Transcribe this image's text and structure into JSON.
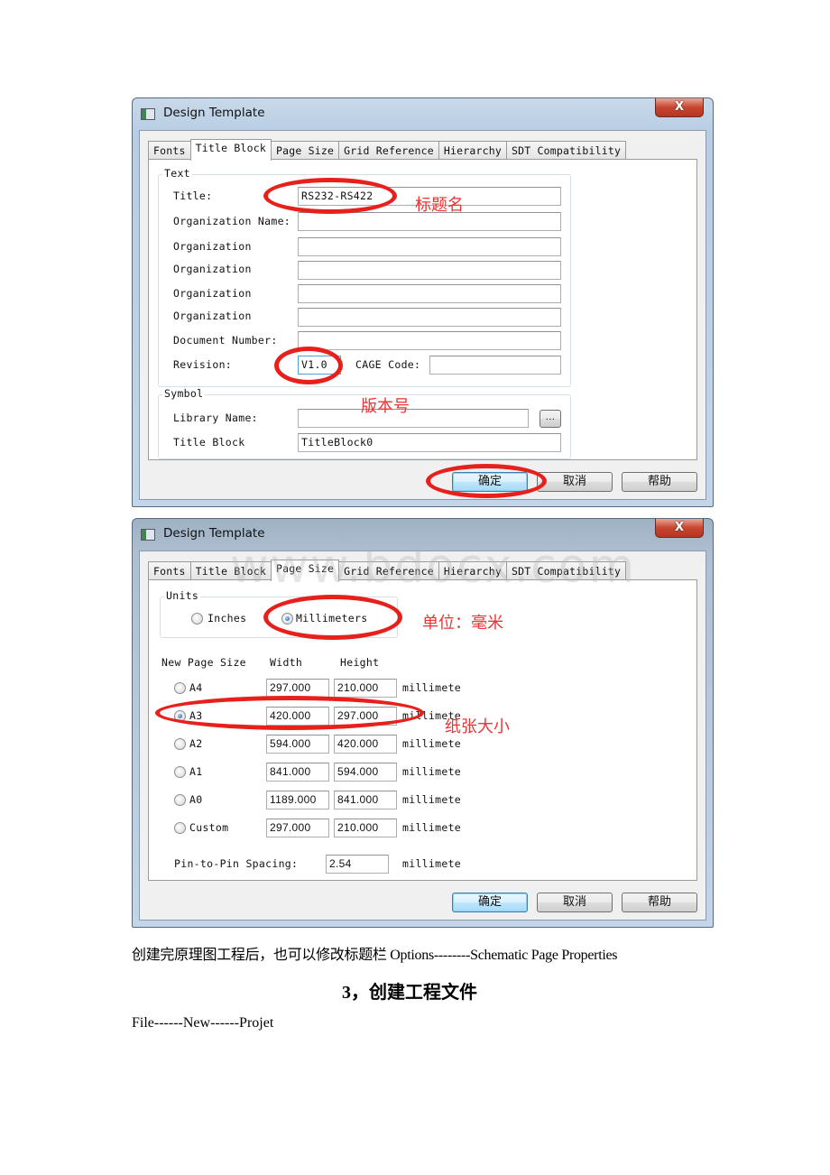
{
  "dialog1": {
    "title": "Design Template",
    "close_label": "X",
    "tabs": [
      "Fonts",
      "Title Block",
      "Page Size",
      "Grid Reference",
      "Hierarchy",
      "SDT Compatibility"
    ],
    "active_tab": "Title Block",
    "text_group": {
      "label": "Text",
      "fields": [
        {
          "label": "Title:",
          "value": "RS232-RS422"
        },
        {
          "label": "Organization Name:",
          "value": ""
        },
        {
          "label": "Organization",
          "value": ""
        },
        {
          "label": "Organization",
          "value": ""
        },
        {
          "label": "Organization",
          "value": ""
        },
        {
          "label": "Organization",
          "value": ""
        },
        {
          "label": "Document Number:",
          "value": ""
        }
      ],
      "revision_label": "Revision:",
      "revision_value": "V1.0",
      "cage_label": "CAGE Code:",
      "cage_value": ""
    },
    "symbol_group": {
      "label": "Symbol",
      "library_label": "Library Name:",
      "library_value": "",
      "browse_label": "...",
      "title_block_label": "Title Block",
      "title_block_value": "TitleBlock0"
    },
    "buttons": {
      "ok": "确定",
      "cancel": "取消",
      "help": "帮助"
    },
    "annotations": {
      "title": "标题名",
      "revision": "版本号"
    }
  },
  "dialog2": {
    "title": "Design Template",
    "close_label": "X",
    "tabs": [
      "Fonts",
      "Title Block",
      "Page Size",
      "Grid Reference",
      "Hierarchy",
      "SDT Compatibility"
    ],
    "active_tab": "Page Size",
    "units": {
      "label": "Units",
      "options": [
        "Inches",
        "Millimeters"
      ],
      "selected": "Millimeters"
    },
    "headers": {
      "size": "New Page Size",
      "width": "Width",
      "height": "Height"
    },
    "sizes": [
      {
        "name": "A4",
        "width": "297.000",
        "height": "210.000",
        "unit": "millimeter",
        "selected": false
      },
      {
        "name": "A3",
        "width": "420.000",
        "height": "297.000",
        "unit": "millimeter",
        "selected": true
      },
      {
        "name": "A2",
        "width": "594.000",
        "height": "420.000",
        "unit": "millimeter",
        "selected": false
      },
      {
        "name": "A1",
        "width": "841.000",
        "height": "594.000",
        "unit": "millimeter",
        "selected": false
      },
      {
        "name": "A0",
        "width": "1189.000",
        "height": "841.000",
        "unit": "millimeter",
        "selected": false
      },
      {
        "name": "Custom",
        "width": "297.000",
        "height": "210.000",
        "unit": "millimeter",
        "selected": false
      }
    ],
    "pin_spacing_label": "Pin-to-Pin Spacing:",
    "pin_spacing_value": "2.54",
    "pin_spacing_unit": "millimeter",
    "buttons": {
      "ok": "确定",
      "cancel": "取消",
      "help": "帮助"
    },
    "annotations": {
      "units": "单位：毫米",
      "paper": "纸张大小"
    }
  },
  "watermark": "www.bdocx.com",
  "document": {
    "paragraph": "创建完原理图工程后，也可以修改标题栏 Options--------Schematic Page Properties",
    "heading": "3，创建工程文件",
    "step": "File------New------Projet"
  }
}
